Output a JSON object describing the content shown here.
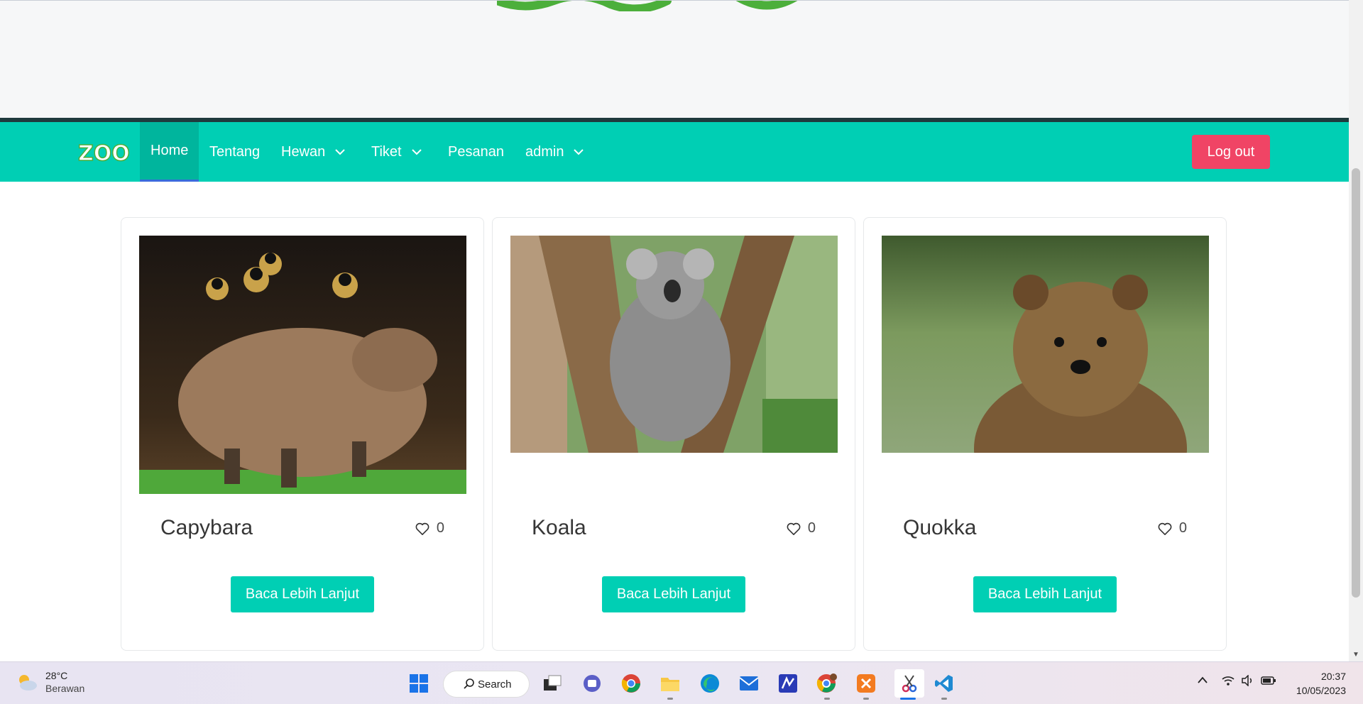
{
  "nav": {
    "brand": "ZOO",
    "items": [
      {
        "label": "Home"
      },
      {
        "label": "Tentang"
      },
      {
        "label": "Hewan"
      },
      {
        "label": "Tiket"
      },
      {
        "label": "Pesanan"
      },
      {
        "label": "admin"
      }
    ],
    "logout_label": "Log out"
  },
  "cards": [
    {
      "title": "Capybara",
      "likes": "0",
      "button": "Baca Lebih Lanjut"
    },
    {
      "title": "Koala",
      "likes": "0",
      "button": "Baca Lebih Lanjut"
    },
    {
      "title": "Quokka",
      "likes": "0",
      "button": "Baca Lebih Lanjut"
    }
  ],
  "colors": {
    "accent": "#00cfb4",
    "logout": "#f04465"
  },
  "taskbar": {
    "weather": {
      "temp": "28°C",
      "condition": "Berawan"
    },
    "search_label": "Search",
    "time": "20:37",
    "date": "10/05/2023"
  }
}
